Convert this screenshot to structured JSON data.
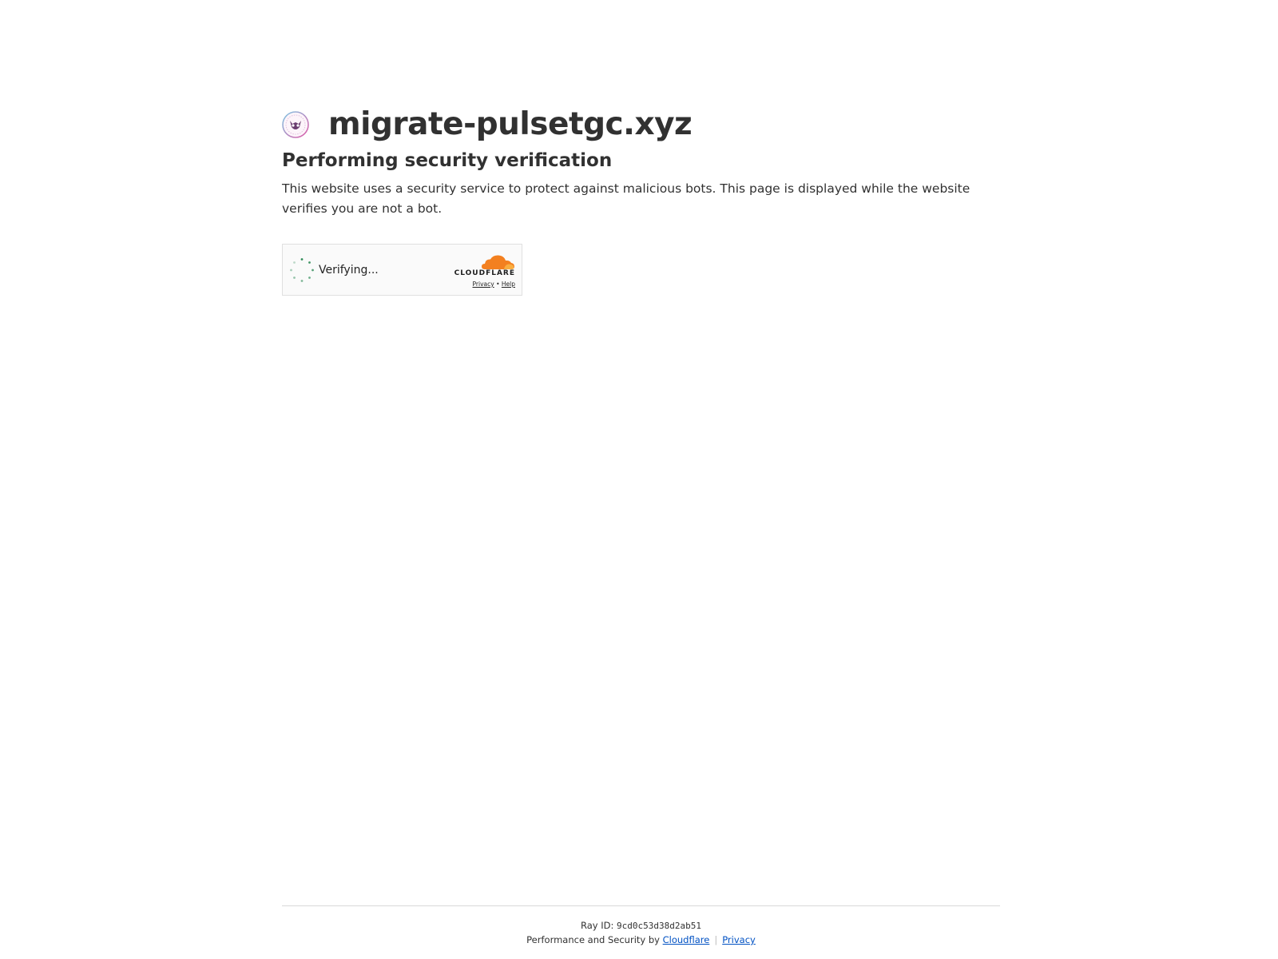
{
  "site": {
    "name": "migrate-pulsetgc.xyz",
    "favicon_icon": "owl-emblem-icon"
  },
  "content": {
    "heading": "Performing security verification",
    "description": "This website uses a security service to protect against malicious bots. This page is displayed while the website verifies you are not a bot."
  },
  "widget": {
    "status_text": "Verifying...",
    "spinner_icon": "loading-spinner-icon",
    "brand_word": "CLOUDFLARE",
    "privacy_link": "Privacy",
    "separator": "•",
    "help_link": "Help",
    "brand_color": "#f38020"
  },
  "footer": {
    "ray_label": "Ray ID: ",
    "ray_id": "9cd0c53d38d2ab51",
    "performance_text": "Performance and Security by ",
    "cloudflare_link": "Cloudflare",
    "divider": "|",
    "privacy_link": "Privacy"
  },
  "colors": {
    "text": "#313131",
    "link": "#0051c3",
    "spinner": "#2e8b57"
  }
}
